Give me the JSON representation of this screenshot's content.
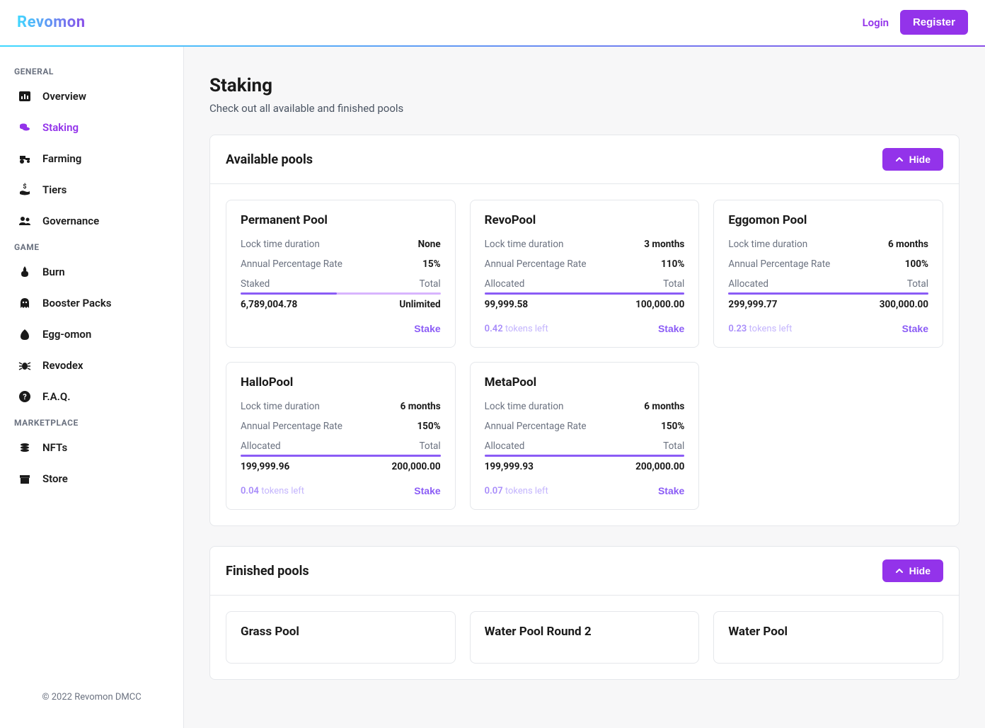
{
  "header": {
    "logo": "Revomon",
    "login": "Login",
    "register": "Register"
  },
  "sidebar": {
    "sections": [
      {
        "title": "GENERAL",
        "items": [
          {
            "label": "Overview",
            "icon": "chart"
          },
          {
            "label": "Staking",
            "icon": "coins",
            "active": true
          },
          {
            "label": "Farming",
            "icon": "tractor"
          },
          {
            "label": "Tiers",
            "icon": "hand-dollar"
          },
          {
            "label": "Governance",
            "icon": "users"
          }
        ]
      },
      {
        "title": "GAME",
        "items": [
          {
            "label": "Burn",
            "icon": "fire"
          },
          {
            "label": "Booster Packs",
            "icon": "ghost"
          },
          {
            "label": "Egg-omon",
            "icon": "egg"
          },
          {
            "label": "Revodex",
            "icon": "bug"
          },
          {
            "label": "F.A.Q.",
            "icon": "question"
          }
        ]
      },
      {
        "title": "MARKETPLACE",
        "items": [
          {
            "label": "NFTs",
            "icon": "stack"
          },
          {
            "label": "Store",
            "icon": "store"
          }
        ]
      }
    ],
    "footer": "© 2022 Revomon DMCC"
  },
  "page": {
    "title": "Staking",
    "subtitle": "Check out all available and finished pools"
  },
  "labels": {
    "lock_time": "Lock time duration",
    "apr": "Annual Percentage Rate",
    "staked": "Staked",
    "allocated": "Allocated",
    "total": "Total",
    "stake": "Stake",
    "tokens_left_suffix": " tokens left",
    "hide": "Hide"
  },
  "sections": {
    "available": {
      "title": "Available pools",
      "pools": [
        {
          "name": "Permanent Pool",
          "lock": "None",
          "apr": "15%",
          "left_label": "Staked",
          "left_value": "6,789,004.78",
          "total": "Unlimited",
          "progress": 48,
          "tokens_left": null
        },
        {
          "name": "RevoPool",
          "lock": "3 months",
          "apr": "110%",
          "left_label": "Allocated",
          "left_value": "99,999.58",
          "total": "100,000.00",
          "progress": 100,
          "tokens_left": "0.42"
        },
        {
          "name": "Eggomon Pool",
          "lock": "6 months",
          "apr": "100%",
          "left_label": "Allocated",
          "left_value": "299,999.77",
          "total": "300,000.00",
          "progress": 100,
          "tokens_left": "0.23"
        },
        {
          "name": "HalloPool",
          "lock": "6 months",
          "apr": "150%",
          "left_label": "Allocated",
          "left_value": "199,999.96",
          "total": "200,000.00",
          "progress": 100,
          "tokens_left": "0.04"
        },
        {
          "name": "MetaPool",
          "lock": "6 months",
          "apr": "150%",
          "left_label": "Allocated",
          "left_value": "199,999.93",
          "total": "200,000.00",
          "progress": 100,
          "tokens_left": "0.07"
        }
      ]
    },
    "finished": {
      "title": "Finished pools",
      "pools": [
        {
          "name": "Grass Pool"
        },
        {
          "name": "Water Pool Round 2"
        },
        {
          "name": "Water Pool"
        }
      ]
    }
  }
}
